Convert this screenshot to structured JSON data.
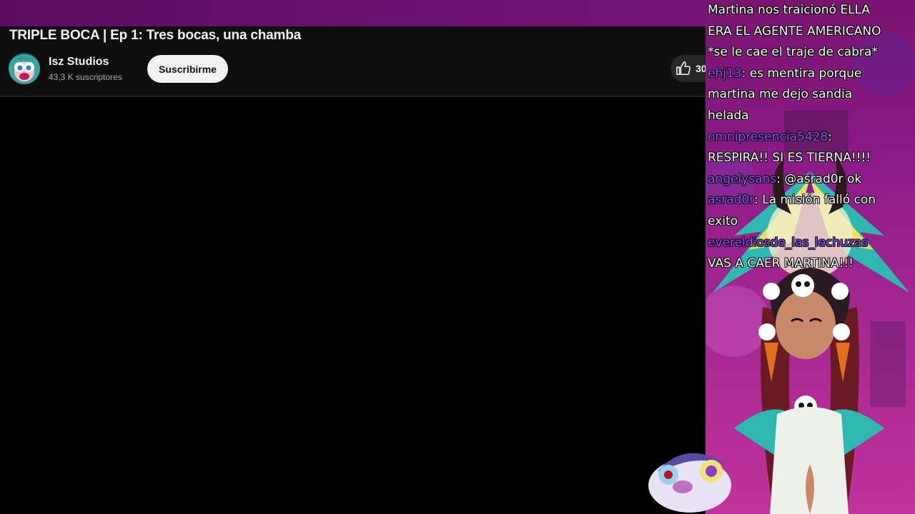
{
  "video": {
    "title": "TRIPLE BOCA | Ep 1: Tres bocas, una chamba",
    "channel_name": "Isz Studios",
    "subscribers": "43,3 K suscriptores",
    "subscribe_label": "Suscribirme",
    "like_count": "30"
  },
  "chat": {
    "lines": [
      [
        {
          "text": "Martina nos traicionó ELLA",
          "user": false
        }
      ],
      [
        {
          "text": "ERA EL AGENTE AMERICANO",
          "user": false
        }
      ],
      [
        {
          "text": "*se le cae el traje de cabra*",
          "user": false
        }
      ],
      [
        {
          "text": "ehj13",
          "user": true
        },
        {
          "text": ": es mentira porque",
          "user": false
        }
      ],
      [
        {
          "text": "martina me dejo sandia",
          "user": false
        }
      ],
      [
        {
          "text": "helada",
          "user": false
        }
      ],
      [
        {
          "text": "omnipresencia5428",
          "user": true
        },
        {
          "text": ":",
          "user": false
        }
      ],
      [
        {
          "text": "RESPIRA!! SI ES TIERNA!!!!",
          "user": false
        }
      ],
      [
        {
          "text": "angelysans",
          "user": true
        },
        {
          "text": ": @asrad0r ok",
          "user": false
        }
      ],
      [
        {
          "text": "asrad0r",
          "user": true
        },
        {
          "text": ": La misión falló con",
          "user": false
        }
      ],
      [
        {
          "text": "exito",
          "user": false
        }
      ],
      [
        {
          "text": "evereldiosde_las_lechuzas",
          "user": true
        }
      ],
      [
        {
          "text": "VAS A CAER MARTINA!!!",
          "user": false
        }
      ]
    ]
  },
  "colors": {
    "accent_purple": "#6d1370",
    "chat_username": "#9b4dff",
    "subscribe_bg": "#f1f1f1"
  },
  "icons": {
    "like": "thumbs-up-icon"
  }
}
